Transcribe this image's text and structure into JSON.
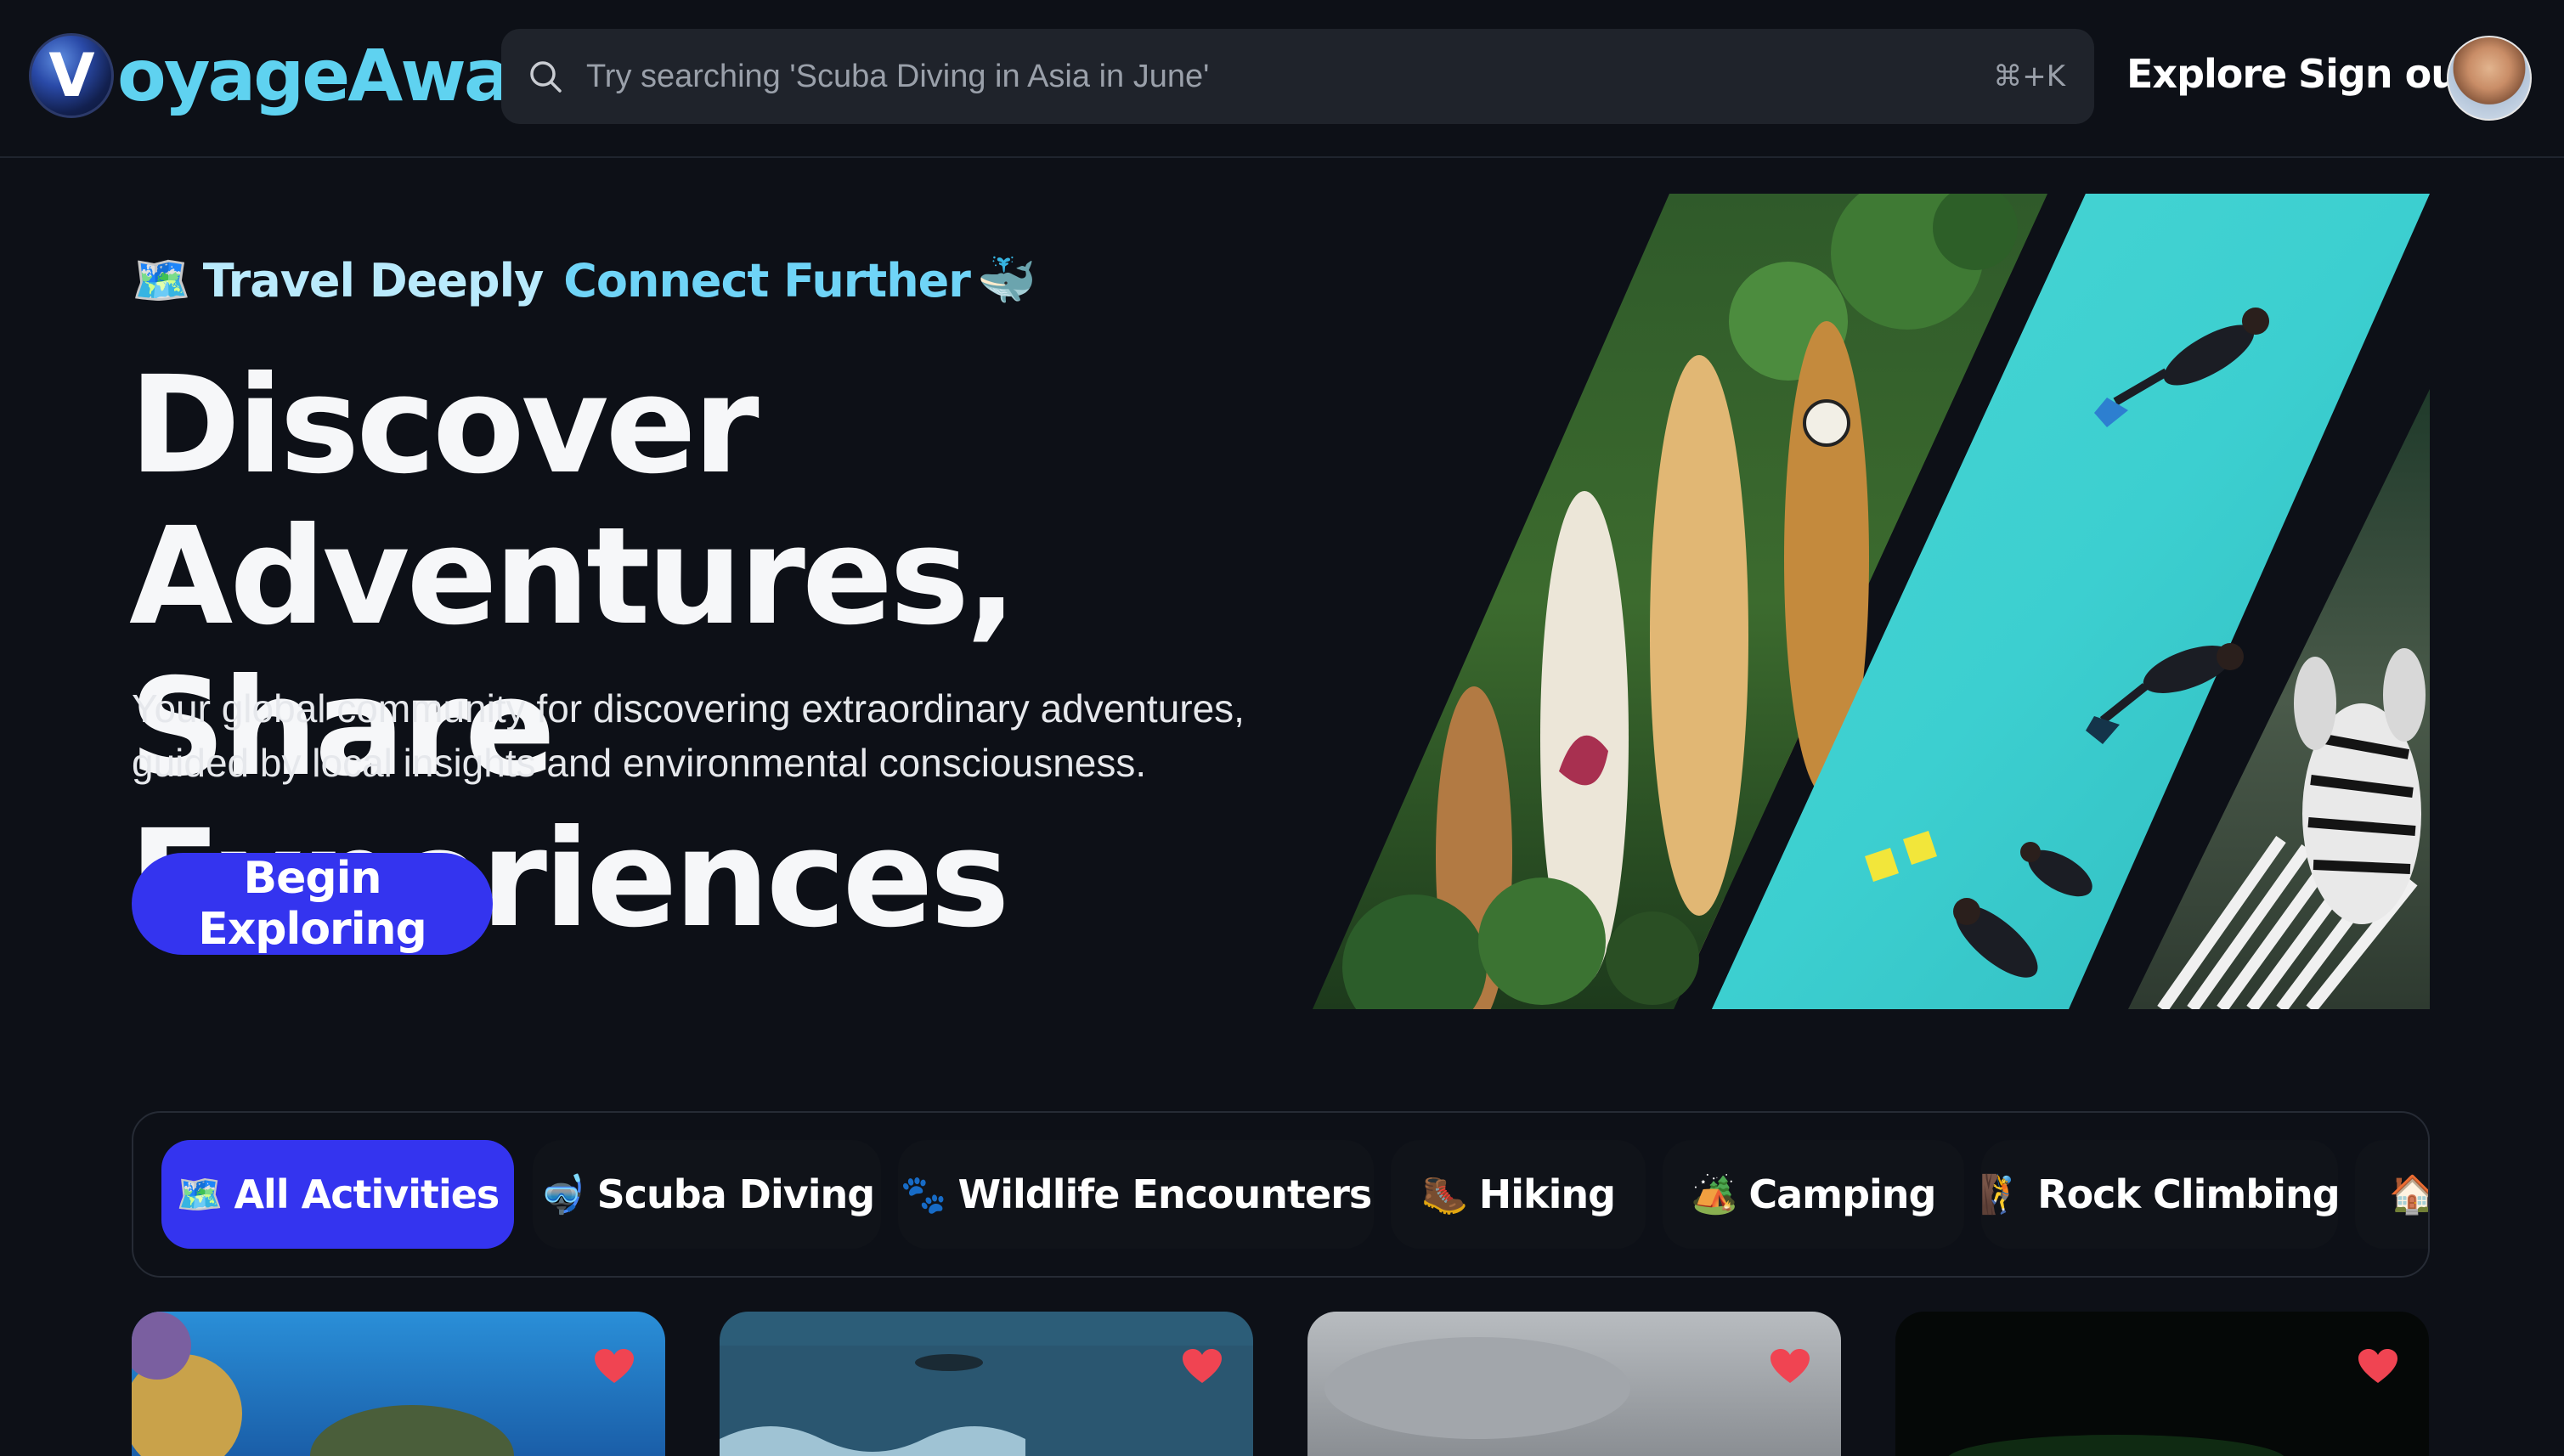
{
  "brand": {
    "logo_initial": "V",
    "logo_rest": "oyageAway"
  },
  "search": {
    "placeholder": "Try searching 'Scuba Diving in Asia in June'",
    "shortcut": "⌘+K"
  },
  "nav": {
    "explore_label": "Explore",
    "signout_label": "Sign out"
  },
  "hero": {
    "tag_emoji": "🗺️",
    "tagline_a": "Travel Deeply",
    "tagline_b": "Connect Further",
    "tag_whale": "🐳",
    "title_line1": "Discover Adventures,",
    "title_line2": "Share Experiences",
    "subtitle_line1": "Your global community for discovering extraordinary adventures,",
    "subtitle_line2": "guided by local insights and environmental consciousness.",
    "cta_label": "Begin Exploring"
  },
  "categories": [
    {
      "emoji": "🗺️",
      "label": "All Activities",
      "active": true
    },
    {
      "emoji": "🤿",
      "label": "Scuba Diving",
      "active": false
    },
    {
      "emoji": "🐾",
      "label": "Wildlife Encounters",
      "active": false
    },
    {
      "emoji": "🥾",
      "label": "Hiking",
      "active": false
    },
    {
      "emoji": "🏕️",
      "label": "Camping",
      "active": false
    },
    {
      "emoji": "🧗",
      "label": "Rock Climbing",
      "active": false
    },
    {
      "emoji": "🏠",
      "label": "",
      "active": false
    }
  ],
  "colors": {
    "accent": "#3434ef",
    "background": "#0d1017",
    "brand_cyan": "#5fd2f0",
    "heart": "#f04452"
  }
}
